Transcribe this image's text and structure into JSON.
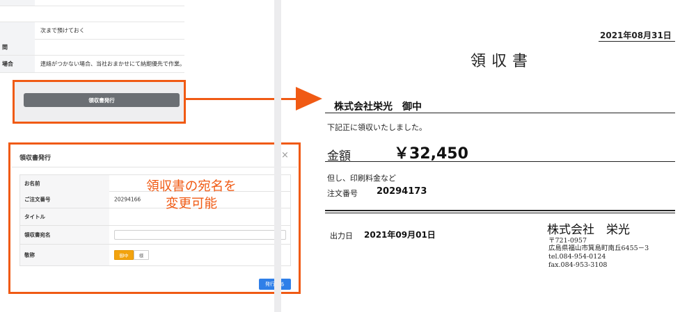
{
  "left_table": {
    "rows": [
      {
        "header": "",
        "value": ""
      },
      {
        "header": "",
        "value": "次まで預けておく"
      },
      {
        "header": "間",
        "value": ""
      },
      {
        "header": "場合",
        "value": "連絡がつかない場合、当社おまかせにて納期優先で作業。"
      }
    ],
    "issue_button_label": "領収書発行"
  },
  "modal": {
    "title": "領収書発行",
    "close_glyph": "×",
    "rows": [
      {
        "label": "お名前",
        "value": ""
      },
      {
        "label": "ご注文番号",
        "value": "20294166"
      },
      {
        "label": "タイトル",
        "value": ""
      },
      {
        "label": "領収書宛名",
        "value": ""
      },
      {
        "label": "敬称",
        "value": ""
      }
    ],
    "honorific_options": [
      "御中",
      "様"
    ],
    "honorific_selected": "御中",
    "submit_label": "発行する",
    "callout_line1": "領収書の宛名を",
    "callout_line2": "変更可能"
  },
  "receipt": {
    "date": "2021年08月31日",
    "title": "領収書",
    "recipient": "株式会社栄光　御中",
    "received_text": "下記正に領収いたしました。",
    "amount_label": "金額",
    "amount": "￥32,450",
    "note": "但し、印刷料金など",
    "order_label": "注文番号",
    "order_number": "20294173",
    "output_label": "出力日",
    "output_date": "2021年09月01日",
    "company": "株式会社　栄光",
    "address_lines": [
      "〒721-0957",
      "広島県福山市箕島町南丘6455－3",
      "tel.084-954-0124",
      "fax.084-953-3108"
    ]
  },
  "colors": {
    "highlight": "#f05a14",
    "primary_button": "#2f7fe8",
    "selected_chip": "#f2a30f"
  }
}
